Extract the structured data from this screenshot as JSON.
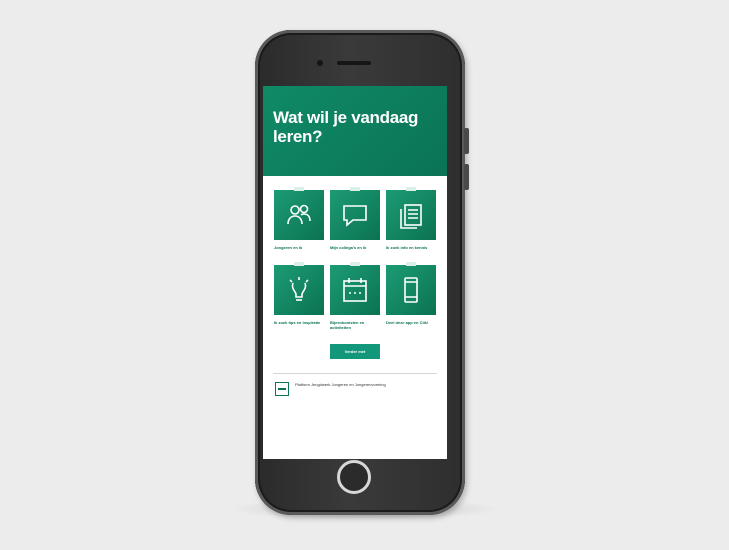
{
  "header": {
    "title": "Wat wil je vandaag leren?"
  },
  "tiles": [
    {
      "icon": "people-icon",
      "label": "Jongeren en ik"
    },
    {
      "icon": "speech-bubble-icon",
      "label": "Mijn collega's en ik"
    },
    {
      "icon": "documents-icon",
      "label": "Ik zoek info en kennis"
    },
    {
      "icon": "lightbulb-icon",
      "label": "Ik zoek tips en inspiratie"
    },
    {
      "icon": "calendar-icon",
      "label": "Bijeenkomsten en activiteiten"
    },
    {
      "icon": "smartphone-icon",
      "label": "Deel deze app en Clik!"
    }
  ],
  "cta": {
    "label": "Verder met"
  },
  "footer": {
    "text": "Platform Jeugdwerk Jongeren en Jongerenvorming"
  },
  "colors": {
    "accent": "#0f8a67",
    "tile": "#1c9b74",
    "background": "#ececec"
  }
}
